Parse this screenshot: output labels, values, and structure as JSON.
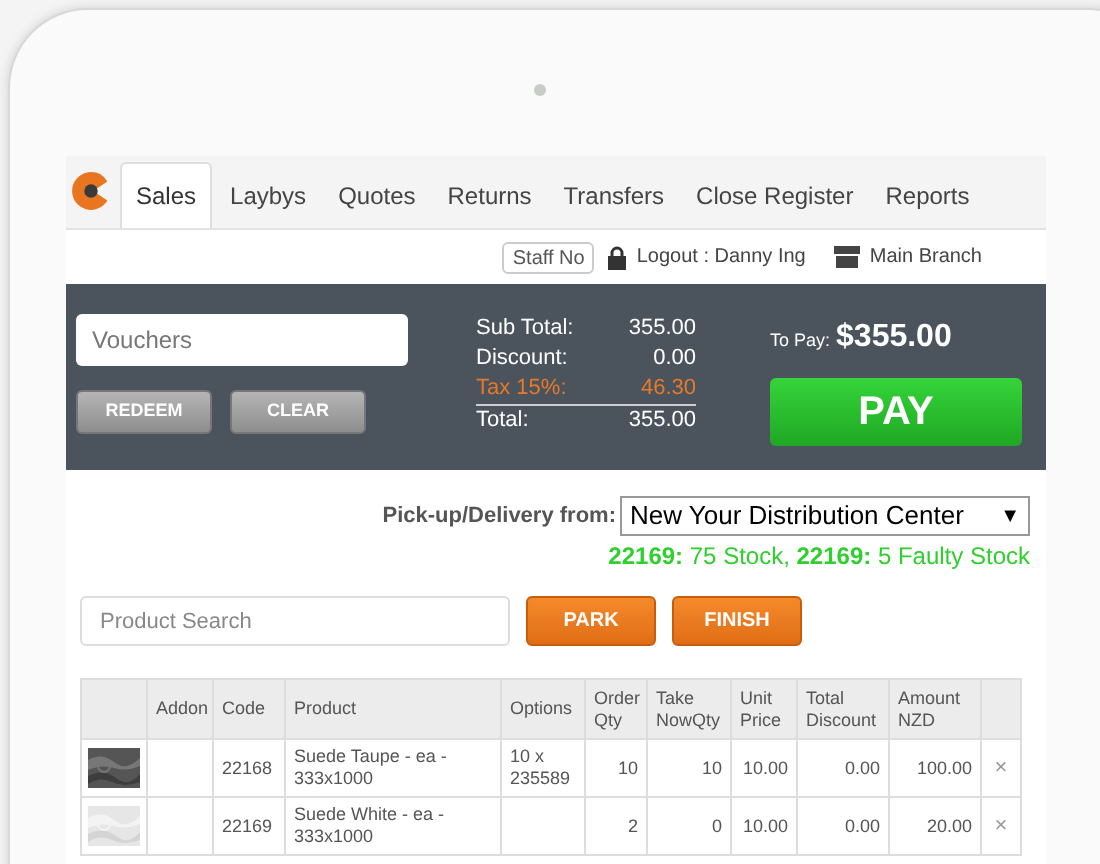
{
  "tabs": [
    {
      "label": "Sales",
      "selected": true
    },
    {
      "label": "Laybys",
      "selected": false
    },
    {
      "label": "Quotes",
      "selected": false
    },
    {
      "label": "Returns",
      "selected": false
    },
    {
      "label": "Transfers",
      "selected": false
    },
    {
      "label": "Close Register",
      "selected": false
    },
    {
      "label": "Reports",
      "selected": false
    }
  ],
  "user_bar": {
    "staff_button": "Staff No",
    "logout": "Logout : Danny Ing",
    "branch": "Main Branch"
  },
  "payment": {
    "voucher_placeholder": "Vouchers",
    "buttons": [
      "REDEEM",
      "CLEAR"
    ],
    "totals": [
      {
        "label": "Sub Total:",
        "value": "355.00",
        "kind": "normal"
      },
      {
        "label": "Discount:",
        "value": "0.00",
        "kind": "normal"
      },
      {
        "label": "Tax 15%:",
        "value": "46.30",
        "kind": "tax"
      },
      {
        "label": "Total:",
        "value": "355.00",
        "kind": "total"
      }
    ],
    "to_pay_label": "To Pay:",
    "to_pay_amount": "$355.00",
    "pay_button": "PAY"
  },
  "delivery": {
    "label": "Pick-up/Delivery from:",
    "location": "New Your Distribution Center",
    "caret": "▼",
    "stock_note": "**22169:** 75 Stock, **22169:** 5 Faulty Stock"
  },
  "search": {
    "placeholder": "Product Search"
  },
  "actions": [
    "PARK",
    "FINISH"
  ],
  "table": {
    "columns": [
      "",
      "Addon",
      "Code",
      "Product",
      "Options",
      "Order Qty",
      "Take NowQty",
      "Unit Price",
      "Total Discount",
      "Amount NZD",
      ""
    ],
    "rows": [
      {
        "addon": "",
        "code": "22168",
        "product": "Suede Taupe - ea - 333x1000",
        "options": "10 x 235589",
        "order_qty": "10",
        "take_now_qty": "10",
        "unit_price": "10.00",
        "total_discount": "0.00",
        "amount": "100.00",
        "remove": "×"
      },
      {
        "addon": "",
        "code": "22169",
        "product": "Suede White - ea - 333x1000",
        "options": "",
        "order_qty": "2",
        "take_now_qty": "0",
        "unit_price": "10.00",
        "total_discount": "0.00",
        "amount": "20.00",
        "remove": "×"
      }
    ]
  }
}
